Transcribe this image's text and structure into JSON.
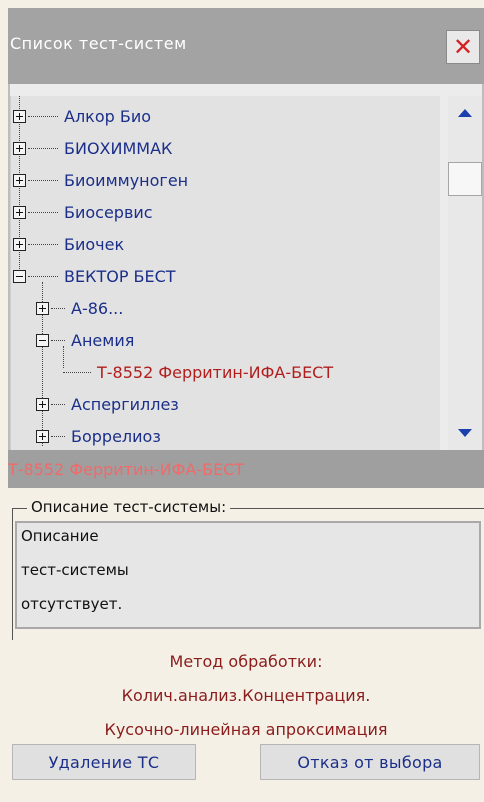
{
  "window": {
    "title": "Список тест-систем",
    "close_label": "✕"
  },
  "tree": {
    "items": [
      {
        "label": "Алкор Био",
        "level": 0,
        "state": "collapsed"
      },
      {
        "label": "БИОХИММАК",
        "level": 0,
        "state": "collapsed"
      },
      {
        "label": "Биоиммуноген",
        "level": 0,
        "state": "collapsed"
      },
      {
        "label": "Биосервис",
        "level": 0,
        "state": "collapsed"
      },
      {
        "label": "Биочек",
        "level": 0,
        "state": "collapsed"
      },
      {
        "label": "ВЕКТОР БЕСТ",
        "level": 0,
        "state": "expanded"
      },
      {
        "label": "А-86...",
        "level": 1,
        "state": "collapsed"
      },
      {
        "label": "Анемия",
        "level": 1,
        "state": "expanded"
      },
      {
        "label": "Т-8552 Ферритин-ИФА-БЕСТ",
        "level": 2,
        "state": "leaf",
        "selected": true
      },
      {
        "label": "Аспергиллез",
        "level": 1,
        "state": "collapsed"
      },
      {
        "label": "Боррелиоз",
        "level": 1,
        "state": "collapsed"
      }
    ]
  },
  "selected_item": "Т-8552 Ферритин-ИФА-БЕСТ",
  "description": {
    "legend": "Описание тест-системы:",
    "lines": [
      "Описание",
      "тест-системы",
      "отсутствует."
    ]
  },
  "method": {
    "heading": "Метод обработки:",
    "line1": "Колич.анализ.Концентрация.",
    "line2": "Кусочно-линейная апроксимация"
  },
  "buttons": {
    "delete": "Удаление ТС",
    "cancel": "Отказ от выбора"
  },
  "colors": {
    "title_bar": "#a3a3a3",
    "tree_text": "#1b2f8a",
    "selected_text": "#b21e1e",
    "method_text": "#8a1c1c",
    "close_x": "#d42020"
  }
}
